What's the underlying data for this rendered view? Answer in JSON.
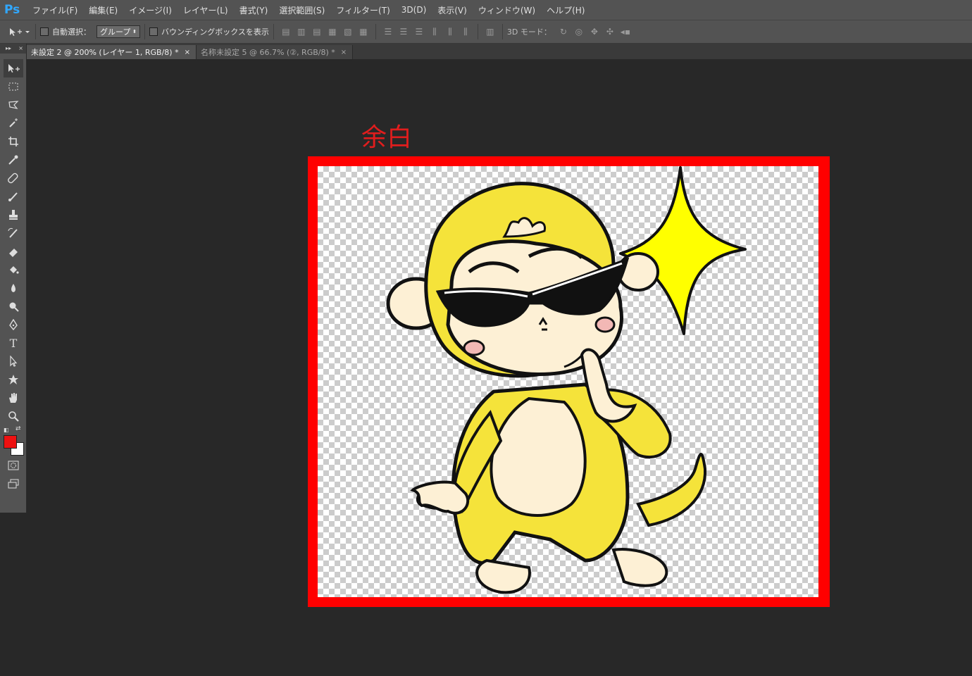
{
  "app": {
    "logo": "Ps"
  },
  "menu": [
    "ファイル(F)",
    "編集(E)",
    "イメージ(I)",
    "レイヤー(L)",
    "書式(Y)",
    "選択範囲(S)",
    "フィルター(T)",
    "3D(D)",
    "表示(V)",
    "ウィンドウ(W)",
    "ヘルプ(H)"
  ],
  "options": {
    "auto_select_label": "自動選択：",
    "auto_select_value": "グループ",
    "bounding_box_label": "バウンディングボックスを表示",
    "mode_3d_label": "3D モード："
  },
  "tabs": [
    {
      "label": "未設定 2 @ 200% (レイヤー 1, RGB/8) *",
      "close": "×"
    },
    {
      "label": "名称未設定 5 @ 66.7% (②, RGB/8) *",
      "close": "×"
    }
  ],
  "toolbox": {
    "collapse": "▸▸",
    "tools": [
      "move",
      "marquee",
      "lasso",
      "magic-wand",
      "crop",
      "eyedropper",
      "healing",
      "brush",
      "stamp",
      "history-brush",
      "eraser",
      "paint-bucket",
      "blur",
      "dodge",
      "pen",
      "type",
      "path-select",
      "shape",
      "hand",
      "zoom"
    ],
    "type_glyph": "T"
  },
  "colors": {
    "foreground": "#ee1111",
    "background": "#ffffff"
  },
  "annotation": "余白",
  "artwork": {
    "description_colors": {
      "monkey": "#f5e33a",
      "star": "#ffff00",
      "face": "#fdf0d5"
    }
  }
}
